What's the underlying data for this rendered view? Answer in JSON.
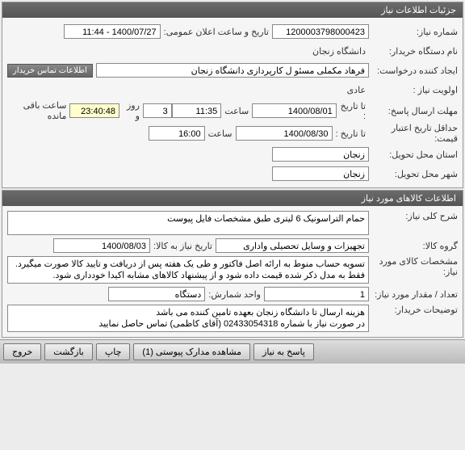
{
  "panel1": {
    "title": "جزئیات اطلاعات نیاز",
    "lbl_need_no": "شماره نیاز:",
    "need_no": "1200003798000423",
    "lbl_announce": "تاریخ و ساعت اعلان عمومی:",
    "announce_val": "1400/07/27 - 11:44",
    "lbl_buyer": "نام دستگاه خریدار:",
    "buyer": "دانشگاه زنجان",
    "lbl_requester": "ایجاد کننده درخواست:",
    "requester": "فرهاد مکملی مسئو ل کارپردازی دانشگاه زنجان",
    "contact_btn": "اطلاعات تماس خریدار",
    "lbl_priority": "اولویت نیاز :",
    "priority": "عادی",
    "lbl_deadline": "مهلت ارسال پاسخ:",
    "lbl_to_date": "تا تاریخ :",
    "deadline_date": "1400/08/01",
    "lbl_hour": "ساعت",
    "deadline_time": "11:35",
    "days": "3",
    "lbl_days_and": "روز و",
    "countdown": "23:40:48",
    "lbl_remaining": "ساعت باقی مانده",
    "lbl_min_valid": "حداقل تاریخ اعتبار قیمت:",
    "valid_date": "1400/08/30",
    "valid_time": "16:00",
    "lbl_province": "استان محل تحویل:",
    "province": "زنجان",
    "lbl_city": "شهر محل تحویل:",
    "city": "زنجان"
  },
  "panel2": {
    "title": "اطلاعات کالاهای مورد نیاز",
    "lbl_desc": "شرح کلی نیاز:",
    "desc": "حمام التراسونیک 6 لیتری طبق مشخصات فایل پیوست",
    "lbl_group": "گروه کالا:",
    "group": "تجهیزات و وسایل تحصیلی واداری",
    "lbl_need_date": "تاریخ نیاز به کالا:",
    "need_date": "1400/08/03",
    "lbl_specs": "مشخصات کالای مورد نیاز:",
    "specs": "تسویه حساب منوط به ارائه اصل فاکتور و طی یک هفته پس از دریافت و تایید کالا صورت میگیرد.\nفقط به مدل ذکر شده قیمت داده شود و از پیشنهاد کالاهای مشابه اکیدا خودداری شود.",
    "lbl_qty": "تعداد / مقدار مورد نیاز:",
    "qty": "1",
    "lbl_unit": "واحد شمارش:",
    "unit": "دستگاه",
    "lbl_notes": "توضیحات خریدار:",
    "notes": "هزینه ارسال تا دانشگاه زنجان بعهده تامین کننده می باشد\nدر صورت نیاز با شماره 02433054318 (آقای کاظمی) تماس حاصل نمایید"
  },
  "toolbar": {
    "reply": "پاسخ به نیاز",
    "attachments": "مشاهده مدارک پیوستی (1)",
    "print": "چاپ",
    "back": "بازگشت",
    "exit": "خروج"
  }
}
